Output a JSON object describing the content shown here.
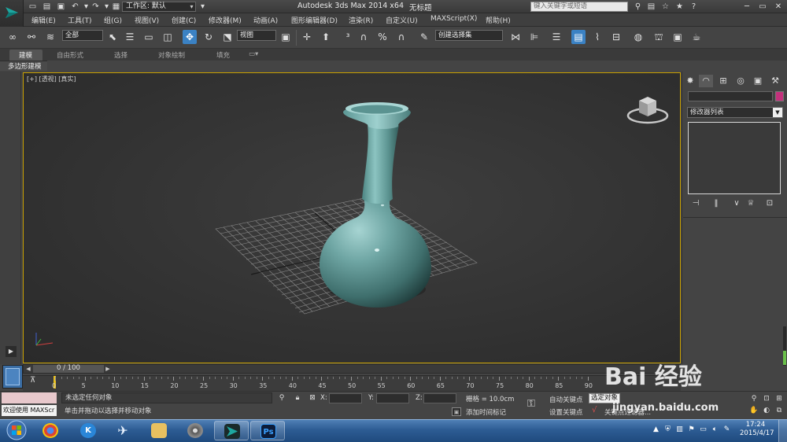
{
  "titlebar": {
    "workspace_label": "工作区: 默认",
    "app_title": "Autodesk 3ds Max  2014 x64",
    "file_title": "无标题",
    "search_placeholder": "键入关键字或短语"
  },
  "menu": {
    "items": [
      "编辑(E)",
      "工具(T)",
      "组(G)",
      "视图(V)",
      "创建(C)",
      "修改器(M)",
      "动画(A)",
      "图形编辑器(D)",
      "渲染(R)",
      "自定义(U)",
      "MAXScript(X)",
      "帮助(H)"
    ]
  },
  "toolbar": {
    "selection_filter": "全部",
    "reference_coord": "视图",
    "named_selection": "创建选择集"
  },
  "ribbon": {
    "tabs": [
      "建模",
      "自由形式",
      "选择",
      "对象绘制",
      "填充"
    ],
    "active_tab": "建模",
    "sub_label": "多边形建模"
  },
  "viewport": {
    "label": "[+] [透视] [真实]"
  },
  "command_panel": {
    "modifier_list": "修改器列表",
    "color_swatch": "#c4307c"
  },
  "timeline": {
    "frame_counter": "0 / 100",
    "ticks": [
      "0",
      "5",
      "10",
      "15",
      "20",
      "25",
      "30",
      "35",
      "40",
      "45",
      "50",
      "55",
      "60",
      "65",
      "70",
      "75",
      "80",
      "85",
      "90"
    ]
  },
  "status": {
    "maxscript_welcome": "欢迎使用 MAXScr",
    "selection_status": "未选定任何对象",
    "prompt": "单击并拖动以选择并移动对象",
    "x_label": "X:",
    "y_label": "Y:",
    "z_label": "Z:",
    "grid": "栅格 = 10.0cm",
    "add_time_tag": "添加时间标记",
    "auto_key": "自动关键点",
    "set_key": "设置关键点",
    "selected": "选定对象",
    "key_filters": "关键点过滤器..."
  },
  "taskbar": {
    "time": "17:24",
    "date": "2015/4/17",
    "photoshop_label": "Ps"
  },
  "watermark": {
    "logo": "Bai 经验",
    "url": "jingyan.baidu.com"
  }
}
